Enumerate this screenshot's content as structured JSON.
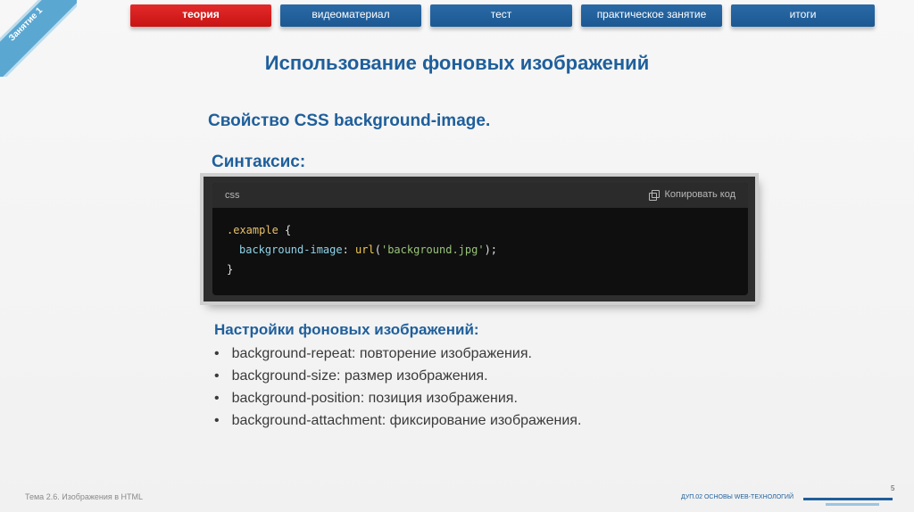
{
  "corner_label": "Занятие 1",
  "nav": {
    "tabs": [
      {
        "label": "теория",
        "active": true
      },
      {
        "label": "видеоматериал",
        "active": false
      },
      {
        "label": "тест",
        "active": false
      },
      {
        "label": "практическое занятие",
        "active": false
      },
      {
        "label": "итоги",
        "active": false
      }
    ]
  },
  "page_title": "Использование фоновых изображений",
  "subtitle": "Свойство CSS background-image.",
  "syntax_label": "Синтаксис:",
  "code": {
    "lang": "css",
    "copy_label": "Копировать код",
    "line1_selector": ".example",
    "line1_brace": " {",
    "line2_prop": "background-image",
    "line2_colon": ": ",
    "line2_fn": "url",
    "line2_open": "(",
    "line2_str": "'background.jpg'",
    "line2_close": ");",
    "line3": "}"
  },
  "settings": {
    "heading": "Настройки фоновых изображений:",
    "items": [
      "background-repeat: повторение изображения.",
      "background-size: размер изображения.",
      "background-position: позиция изображения.",
      "background-attachment: фиксирование изображения."
    ]
  },
  "footer": {
    "left": "Тема 2.6. Изображения в HTML",
    "right": "ДУП.02  ОСНОВЫ WEB-ТЕХНОЛОГИЙ",
    "page": "5"
  },
  "colors": {
    "accent": "#1f5f9b",
    "active_tab": "#d41f1f",
    "tab": "#1f5b95"
  }
}
